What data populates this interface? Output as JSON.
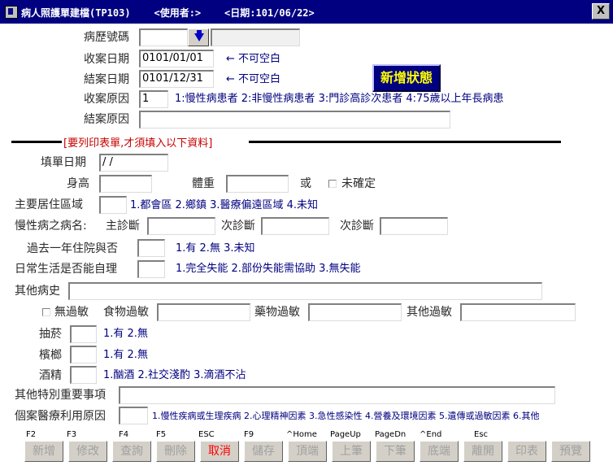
{
  "window": {
    "title": "病人照護單建檔(TP103)    <使用者:>    <日期:101/06/22>",
    "close_label": "X"
  },
  "header": {
    "chart_no_label": "病歷號碼",
    "chart_no_value": "",
    "patient_name_value": "",
    "open_date_label": "收案日期",
    "open_date_value": "0101/01/01",
    "close_date_label": "結案日期",
    "close_date_value": "0101/12/31",
    "required_hint_1": "← 不可空白",
    "required_hint_2": "← 不可空白",
    "reason_label": "收案原因",
    "reason_value": "1",
    "reason_options": "1:慢性病患者 2:非慢性病患者 3:門診高診次患者 4:75歲以上年長病患",
    "close_reason_label": "結案原因",
    "close_reason_value": "",
    "status_badge": "新增狀態"
  },
  "section_title": "[要列印表單,才須填入以下資料]",
  "form": {
    "fill_date_label": "填單日期",
    "fill_date_value": " / /",
    "height_label": "身高",
    "height_value": "",
    "weight_label": "體重",
    "weight_value": "",
    "or_label": "或",
    "undetermined_label": "未確定",
    "residence_label": "主要居住區域",
    "residence_value": "",
    "residence_options": "1.都會區 2.鄉鎮 3.醫療偏遠區域 4.未知",
    "chronic_label": "慢性病之病名:",
    "primary_dx_label": "主診斷",
    "primary_dx_value": "",
    "secondary_dx_label_1": "次診斷",
    "secondary_dx_value_1": "",
    "secondary_dx_label_2": "次診斷",
    "secondary_dx_value_2": "",
    "hospitalized_label": "過去一年住院與否",
    "hospitalized_value": "",
    "hospitalized_options": "1.有 2.無 3.未知",
    "selfcare_label": "日常生活是否能自理",
    "selfcare_value": "",
    "selfcare_options": "1.完全失能 2.部份失能需協助 3.無失能",
    "other_history_label": "其他病史",
    "other_history_value": "",
    "no_allergy_label": "無過敏",
    "food_allergy_label": "食物過敏",
    "food_allergy_value": "",
    "drug_allergy_label": "藥物過敏",
    "drug_allergy_value": "",
    "other_allergy_label": "其他過敏",
    "other_allergy_value": "",
    "smoking_label": "抽菸",
    "smoking_value": "",
    "smoking_options": "1.有 2.無",
    "betel_label": "檳榔",
    "betel_value": "",
    "betel_options": "1.有 2.無",
    "alcohol_label": "酒精",
    "alcohol_value": "",
    "alcohol_options": "1.酗酒 2.社交淺酌 3.滴酒不沾",
    "notes_label": "其他特別重要事項",
    "notes_value": "",
    "utilization_label": "個案醫療利用原因",
    "utilization_value": "",
    "utilization_options": "1.慢性疾病或生理疾病 2.心理精神因素 3.急性感染性 4.營養及環境因素 5.遺傳或過敏因素 6.其他"
  },
  "toolbar": {
    "buttons": [
      {
        "key": "F2",
        "label": "新增"
      },
      {
        "key": "F3",
        "label": "修改"
      },
      {
        "key": "F4",
        "label": "查詢"
      },
      {
        "key": "F5",
        "label": "刪除"
      },
      {
        "key": "ESC",
        "label": "取消"
      },
      {
        "key": "F9",
        "label": "儲存"
      },
      {
        "key": "^Home",
        "label": "頂端"
      },
      {
        "key": "PageUp",
        "label": "上筆"
      },
      {
        "key": "PageDn",
        "label": "下筆"
      },
      {
        "key": "^End",
        "label": "底端"
      },
      {
        "key": "Esc",
        "label": "離開"
      },
      {
        "key": "",
        "label": "印表"
      },
      {
        "key": "",
        "label": "預覽"
      }
    ]
  },
  "colors": {
    "titlebar": "#000080",
    "label_text": "#2a2a2a",
    "hint_text": "#000080",
    "section_title": "#c80000",
    "status_badge_bg": "#000080",
    "status_badge_text": "#ffff00",
    "active_button_text": "#ff0000",
    "disabled_button_text": "#a0a0a0"
  }
}
